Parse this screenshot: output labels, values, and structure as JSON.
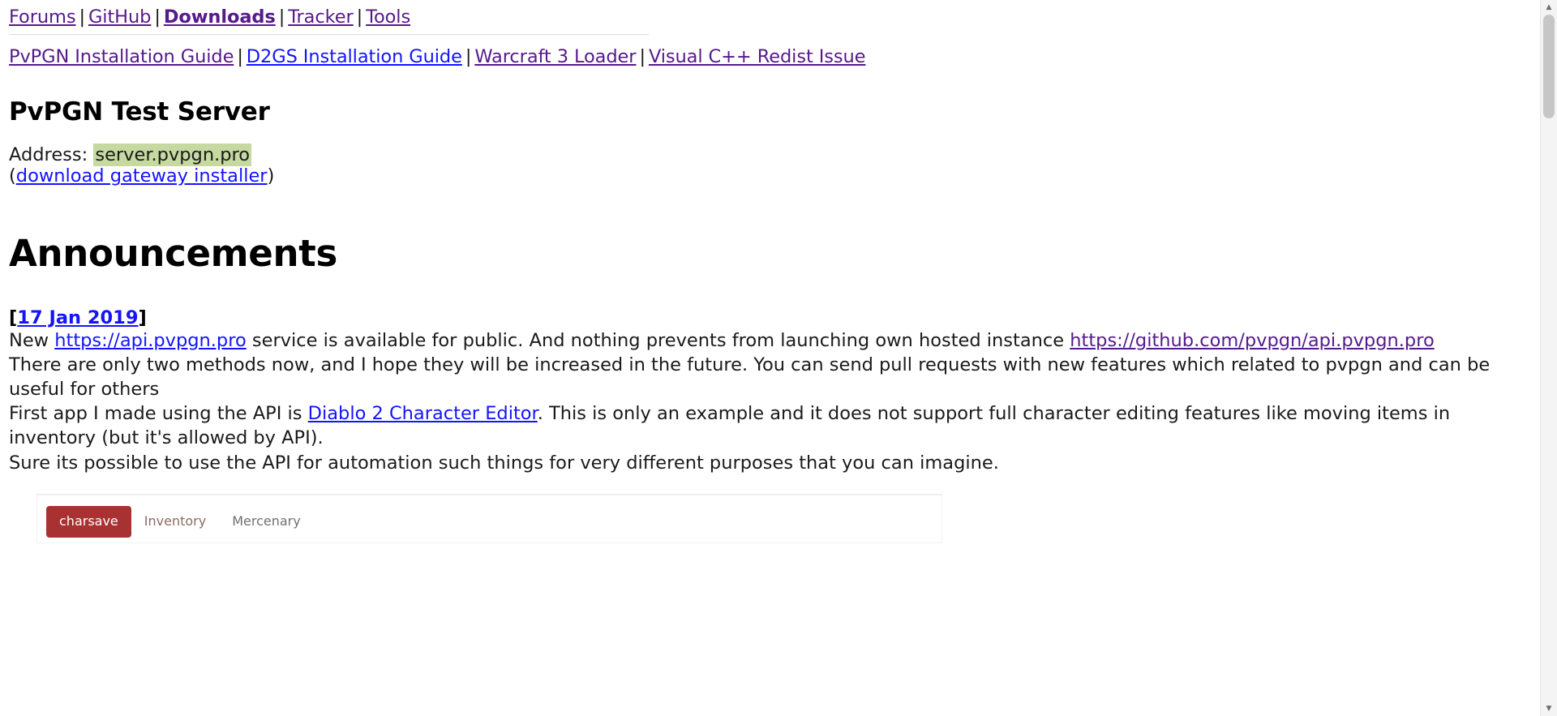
{
  "nav": {
    "primary": [
      {
        "label": "Forums",
        "state": "visited",
        "bold": false
      },
      {
        "label": "GitHub",
        "state": "visited",
        "bold": false
      },
      {
        "label": "Downloads",
        "state": "visited",
        "bold": true
      },
      {
        "label": "Tracker",
        "state": "visited",
        "bold": false
      },
      {
        "label": "Tools",
        "state": "visited",
        "bold": false
      }
    ],
    "secondary": [
      {
        "label": "PvPGN Installation Guide",
        "state": "visited"
      },
      {
        "label": "D2GS Installation Guide",
        "state": "fresh"
      },
      {
        "label": "Warcraft 3 Loader",
        "state": "visited"
      },
      {
        "label": "Visual C++ Redist Issue",
        "state": "visited"
      }
    ],
    "separator": "|"
  },
  "test_server": {
    "heading": "PvPGN Test Server",
    "address_label": "Address:",
    "address_value": "server.pvpgn.pro",
    "highlight_color": "#c5d9a0",
    "installer_open_paren": "(",
    "installer_link": "download gateway installer",
    "installer_close_paren": ")"
  },
  "announcements": {
    "heading": "Announcements",
    "entry": {
      "open_bracket": "[",
      "date": "17 Jan 2019",
      "close_bracket": "]",
      "paragraph1": {
        "prefix": "New ",
        "link1": "https://api.pvpgn.pro",
        "middle": " service is available for public. And nothing prevents from launching own hosted instance ",
        "link2": "https://github.com/pvpgn/api.pvpgn.pro"
      },
      "paragraph2": "There are only two methods now, and I hope they will be increased in the future. You can send pull requests with new features which related to pvpgn and can be useful for others",
      "paragraph3": {
        "prefix": "First app I made using the API is ",
        "link": "Diablo 2 Character Editor",
        "suffix": ". This is only an example and it does not support full character editing features like moving items in inventory (but it's allowed by API).",
        "line2": "Sure its possible to use the API for automation such things for very different purposes that you can imagine."
      }
    }
  },
  "app_screenshot": {
    "tabs": [
      {
        "label": "charsave",
        "active": true
      },
      {
        "label": "Inventory",
        "active": false
      },
      {
        "label": "Mercenary",
        "active": false
      }
    ],
    "active_color": "#a83232"
  },
  "scrollbar": {
    "up_arrow": "▲",
    "down_arrow": "▼"
  }
}
